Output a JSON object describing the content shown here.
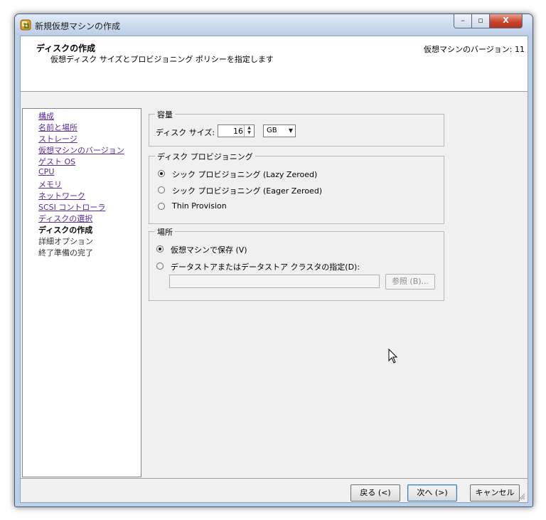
{
  "window": {
    "title": "新規仮想マシンの作成",
    "controls": {
      "minimize": "–",
      "maximize": "▫",
      "close": "X"
    },
    "close_color": "#c9462c"
  },
  "header": {
    "title": "ディスクの作成",
    "subtitle": "仮想ディスク サイズとプロビジョニング ポリシーを指定します",
    "version_label": "仮想マシンのバージョン: 11"
  },
  "nav": {
    "items": [
      {
        "label": "構成",
        "state": "link"
      },
      {
        "label": "名前と場所",
        "state": "link"
      },
      {
        "label": "ストレージ",
        "state": "link"
      },
      {
        "label": "仮想マシンのバージョン",
        "state": "link"
      },
      {
        "label": "ゲスト OS",
        "state": "link"
      },
      {
        "label": "CPU",
        "state": "link"
      },
      {
        "label": "メモリ",
        "state": "link"
      },
      {
        "label": "ネットワーク",
        "state": "link"
      },
      {
        "label": "SCSI コントローラ",
        "state": "link"
      },
      {
        "label": "ディスクの選択",
        "state": "link"
      },
      {
        "label": "ディスクの作成",
        "state": "current"
      },
      {
        "label": "詳細オプション",
        "state": "future"
      },
      {
        "label": "終了準備の完了",
        "state": "future"
      }
    ],
    "link_color": "#5b2a9c"
  },
  "capacity": {
    "legend": "容量",
    "disk_size_label": "ディスク サイズ:",
    "disk_size_value": "16",
    "unit_value": "GB"
  },
  "provisioning": {
    "legend": "ディスク プロビジョニング",
    "options": [
      {
        "label": "シック プロビジョニング (Lazy Zeroed)",
        "checked": true
      },
      {
        "label": "シック プロビジョニング (Eager Zeroed)",
        "checked": false
      },
      {
        "label": "Thin Provision",
        "checked": false
      }
    ]
  },
  "location": {
    "legend": "場所",
    "options": [
      {
        "label": "仮想マシンで保存 (V)",
        "checked": true
      },
      {
        "label": "データストアまたはデータストア クラスタの指定(D):",
        "checked": false
      }
    ],
    "datastore_value": "",
    "browse_label": "参照 (B)..."
  },
  "footer": {
    "back_label": "戻る (<)",
    "next_label": "次へ (>)",
    "cancel_label": "キャンセル"
  },
  "icons": [
    "app-icon",
    "spin-up-icon",
    "spin-down-icon",
    "dropdown-arrow-icon",
    "resize-grip-icon",
    "mouse-cursor-icon"
  ]
}
